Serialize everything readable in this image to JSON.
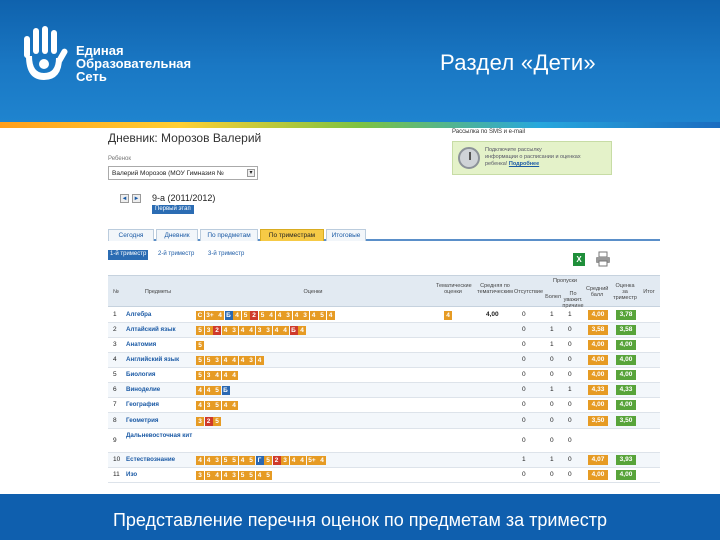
{
  "header": {
    "logo_lines": [
      "Единая",
      "Образовательная",
      "Сеть"
    ],
    "title": "Раздел «Дети»"
  },
  "footer": {
    "caption": "Представление перечня оценок  по предметам за триместр"
  },
  "screen": {
    "diary_title": "Дневник: Морозов Валерий",
    "child_label": "Ребенок",
    "child_value": "Валерий Морозов (МОУ Гимназия №",
    "notice_label": "Рассылка по SMS и e-mail",
    "notice_lines": [
      "Подключите рассылку",
      "информации о расписании и оценках",
      "ребенка!"
    ],
    "notice_link": "Подробнее",
    "period_title": "9-а (2011/2012)",
    "period_sub": "Первый этап",
    "tabs": [
      "Сегодня",
      "Дневник",
      "По предметам",
      "По триместрам",
      "Итоговые"
    ],
    "active_tab": "По триместрам",
    "subtabs": [
      "1-й триместр",
      "2-й триместр",
      "3-й триместр"
    ],
    "active_subtab": "1-й триместр",
    "icons": {
      "excel": "excel-icon",
      "print": "printer-icon"
    },
    "colors": {
      "grade_orange": "#e69b24",
      "grade_red": "#cf3a2b",
      "grade_blue": "#2a68b2",
      "grade_green": "#58a43a"
    }
  },
  "table": {
    "headers": {
      "num": "№",
      "subject": "Предметы",
      "grades": "Оценки",
      "tematic": "Тематические оценки",
      "avg_tematic": "Средняя по тематическим",
      "missed": "Отсутствие",
      "absences": "Пропуски",
      "ill": "Болел",
      "valid": "По уважит. причине",
      "avg_score": "Средний балл",
      "term": "Оценка за триместр",
      "final": "Итог"
    },
    "rows": [
      {
        "num": "1",
        "subject": "Алгебра",
        "grades": [
          [
            "С",
            "gc-orange"
          ],
          [
            "3+",
            "gc-orange"
          ],
          [
            "4",
            "gc-orange"
          ],
          [
            "Б",
            "gc-blue"
          ],
          [
            "4",
            "gc-orange"
          ],
          [
            "5",
            "gc-orange"
          ],
          [
            "2",
            "gc-red"
          ],
          [
            "5",
            "gc-orange"
          ],
          [
            "4",
            "gc-orange"
          ],
          [
            "4",
            "gc-orange"
          ],
          [
            "3",
            "gc-orange"
          ],
          [
            "4",
            "gc-orange"
          ],
          [
            "3",
            "gc-orange"
          ],
          [
            "4",
            "gc-orange"
          ],
          [
            "5",
            "gc-orange"
          ],
          [
            "4",
            "gc-orange"
          ]
        ],
        "tematic": "4",
        "avg_tematic": "4,00",
        "missed": "0",
        "ill": "1",
        "valid": "1",
        "avg": "4,00",
        "term": "3,78"
      },
      {
        "num": "2",
        "subject": "Алтайский язык",
        "grades": [
          [
            "5",
            "gc-orange"
          ],
          [
            "3",
            "gc-orange"
          ],
          [
            "2",
            "gc-red"
          ],
          [
            "4",
            "gc-orange"
          ],
          [
            "3",
            "gc-orange"
          ],
          [
            "4",
            "gc-orange"
          ],
          [
            "4",
            "gc-orange"
          ],
          [
            "3",
            "gc-orange"
          ],
          [
            "3",
            "gc-orange"
          ],
          [
            "4",
            "gc-orange"
          ],
          [
            "4",
            "gc-orange"
          ],
          [
            "Б",
            "gc-red"
          ],
          [
            "4",
            "gc-orange"
          ]
        ],
        "tematic": "",
        "avg_tematic": "",
        "missed": "0",
        "ill": "1",
        "valid": "0",
        "avg": "3,58",
        "term": "3,58"
      },
      {
        "num": "3",
        "subject": "Анатомия",
        "grades": [
          [
            "5",
            "gc-orange"
          ]
        ],
        "tematic": "",
        "avg_tematic": "",
        "missed": "0",
        "ill": "1",
        "valid": "0",
        "avg": "4,00",
        "term": "4,00"
      },
      {
        "num": "4",
        "subject": "Английский язык",
        "grades": [
          [
            "5",
            "gc-orange"
          ],
          [
            "5",
            "gc-orange"
          ],
          [
            "3",
            "gc-orange"
          ],
          [
            "4",
            "gc-orange"
          ],
          [
            "4",
            "gc-orange"
          ],
          [
            "4",
            "gc-orange"
          ],
          [
            "3",
            "gc-orange"
          ],
          [
            "4",
            "gc-orange"
          ]
        ],
        "tematic": "",
        "avg_tematic": "",
        "missed": "0",
        "ill": "0",
        "valid": "0",
        "avg": "4,00",
        "term": "4,00"
      },
      {
        "num": "5",
        "subject": "Биология",
        "grades": [
          [
            "5",
            "gc-orange"
          ],
          [
            "3",
            "gc-orange"
          ],
          [
            "4",
            "gc-orange"
          ],
          [
            "4",
            "gc-orange"
          ],
          [
            "4",
            "gc-orange"
          ]
        ],
        "tematic": "",
        "avg_tematic": "",
        "missed": "0",
        "ill": "0",
        "valid": "0",
        "avg": "4,00",
        "term": "4,00"
      },
      {
        "num": "6",
        "subject": "Виноделие",
        "grades": [
          [
            "4",
            "gc-orange"
          ],
          [
            "4",
            "gc-orange"
          ],
          [
            "5",
            "gc-orange"
          ],
          [
            "Б",
            "gc-blue"
          ]
        ],
        "tematic": "",
        "avg_tematic": "",
        "missed": "0",
        "ill": "1",
        "valid": "1",
        "avg": "4,33",
        "term": "4,33"
      },
      {
        "num": "7",
        "subject": "География",
        "grades": [
          [
            "4",
            "gc-orange"
          ],
          [
            "3",
            "gc-orange"
          ],
          [
            "5",
            "gc-orange"
          ],
          [
            "4",
            "gc-orange"
          ],
          [
            "4",
            "gc-orange"
          ]
        ],
        "tematic": "",
        "avg_tematic": "",
        "missed": "0",
        "ill": "0",
        "valid": "0",
        "avg": "4,00",
        "term": "4,00"
      },
      {
        "num": "8",
        "subject": "Геометрия",
        "grades": [
          [
            "3",
            "gc-orange"
          ],
          [
            "2",
            "gc-red"
          ],
          [
            "5",
            "gc-orange"
          ]
        ],
        "tematic": "",
        "avg_tematic": "",
        "missed": "0",
        "ill": "0",
        "valid": "0",
        "avg": "3,50",
        "term": "3,50"
      },
      {
        "num": "9",
        "subject": "Дальневосточная кит",
        "grades": [],
        "tematic": "",
        "avg_tematic": "",
        "missed": "0",
        "ill": "0",
        "valid": "0",
        "avg": "",
        "term": ""
      },
      {
        "num": "10",
        "subject": "Естествознание",
        "grades": [
          [
            "4",
            "gc-orange"
          ],
          [
            "4",
            "gc-orange"
          ],
          [
            "3",
            "gc-orange"
          ],
          [
            "5",
            "gc-orange"
          ],
          [
            "5",
            "gc-orange"
          ],
          [
            "4",
            "gc-orange"
          ],
          [
            "5",
            "gc-orange"
          ],
          [
            "Г",
            "gc-blue"
          ],
          [
            "5",
            "gc-orange"
          ],
          [
            "2",
            "gc-red"
          ],
          [
            "3",
            "gc-orange"
          ],
          [
            "4",
            "gc-orange"
          ],
          [
            "4",
            "gc-orange"
          ],
          [
            "5+",
            "gc-orange"
          ],
          [
            "4",
            "gc-orange"
          ]
        ],
        "tematic": "",
        "avg_tematic": "",
        "missed": "1",
        "ill": "1",
        "valid": "0",
        "avg": "4,07",
        "term": "3,93"
      },
      {
        "num": "11",
        "subject": "Изо",
        "grades": [
          [
            "3",
            "gc-orange"
          ],
          [
            "5",
            "gc-orange"
          ],
          [
            "4",
            "gc-orange"
          ],
          [
            "4",
            "gc-orange"
          ],
          [
            "3",
            "gc-orange"
          ],
          [
            "5",
            "gc-orange"
          ],
          [
            "5",
            "gc-orange"
          ],
          [
            "4",
            "gc-orange"
          ],
          [
            "5",
            "gc-orange"
          ]
        ],
        "tematic": "",
        "avg_tematic": "",
        "missed": "0",
        "ill": "0",
        "valid": "0",
        "avg": "4,00",
        "term": "4,00"
      }
    ]
  }
}
